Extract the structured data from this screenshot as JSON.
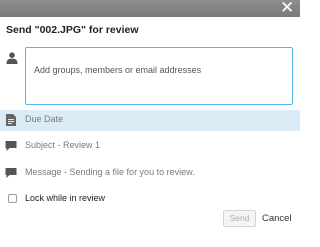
{
  "window": {
    "close_icon": "close-icon"
  },
  "dialog": {
    "title": "Send \"002.JPG\" for review"
  },
  "recipients": {
    "icon": "person-icon",
    "placeholder": "Add groups, members or email addresses",
    "value": ""
  },
  "options": {
    "due_date": {
      "icon": "document-icon",
      "label": "Due Date"
    },
    "subject": {
      "icon": "speech-bubble-icon",
      "label": "Subject - Review 1"
    },
    "message": {
      "icon": "speech-bubble-icon",
      "label": "Message - Sending a file for you to review."
    }
  },
  "lock": {
    "label": "Lock while in review",
    "checked": false
  },
  "footer": {
    "send_label": "Send",
    "cancel_label": "Cancel"
  },
  "colors": {
    "accent": "#55b8ea",
    "highlight_row": "#dcecf7",
    "titlebar": "#848484"
  }
}
